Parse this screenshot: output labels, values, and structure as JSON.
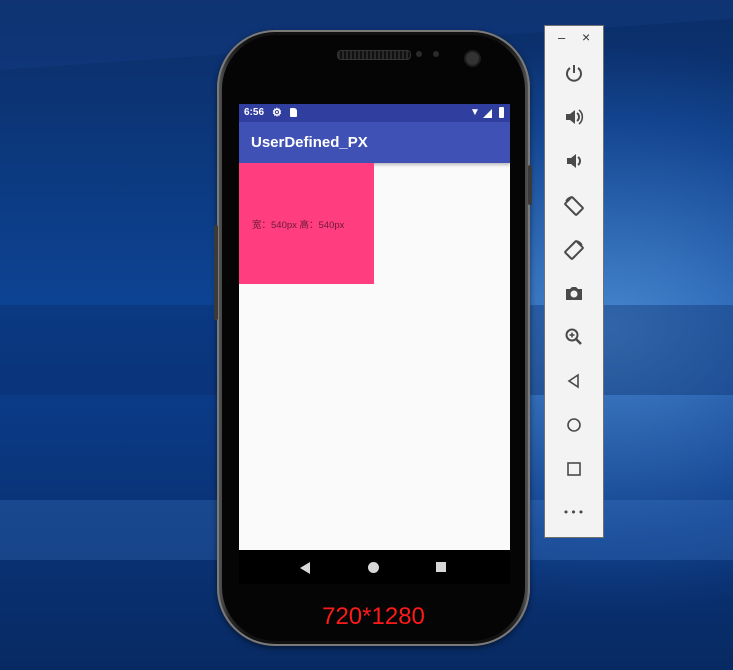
{
  "emulator": {
    "window_controls": {
      "minimize": "–",
      "close": "×"
    },
    "toolbar": [
      {
        "name": "power-icon"
      },
      {
        "name": "volume-up-icon"
      },
      {
        "name": "volume-down-icon"
      },
      {
        "name": "rotate-left-icon"
      },
      {
        "name": "rotate-right-icon"
      },
      {
        "name": "camera-icon"
      },
      {
        "name": "zoom-icon"
      },
      {
        "name": "back-icon"
      },
      {
        "name": "home-icon"
      },
      {
        "name": "overview-icon"
      },
      {
        "name": "more-icon",
        "label": "•••"
      }
    ]
  },
  "device": {
    "status_bar": {
      "time": "6:56",
      "icons": [
        "gear-icon",
        "sd-card-icon",
        "wifi-icon",
        "signal-icon",
        "battery-icon"
      ]
    },
    "app_bar": {
      "title": "UserDefined_PX"
    },
    "content": {
      "box_label": "宽：540px  高：540px",
      "box_color": "#ff3d7f"
    },
    "nav_bar": {
      "buttons": [
        "back-icon",
        "home-icon",
        "recents-icon"
      ]
    },
    "resolution_caption": "720*1280",
    "colors": {
      "status_bar": "#303f9f",
      "app_bar": "#3f51b5",
      "caption": "#ff1a1a"
    }
  }
}
